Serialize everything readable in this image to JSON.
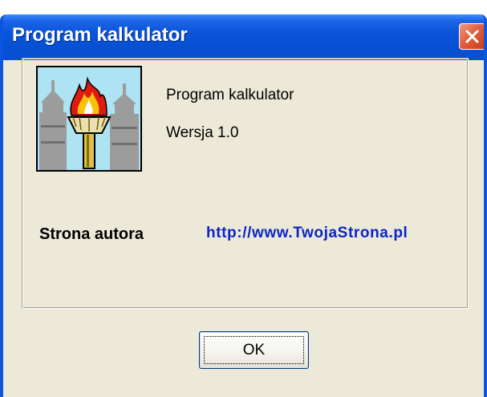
{
  "window": {
    "title": "Program kalkulator"
  },
  "about": {
    "program_name": "Program kalkulator",
    "version": "Wersja 1.0",
    "author_label": "Strona autora",
    "author_url": "http://www.TwojaStrona.pl"
  },
  "buttons": {
    "ok_label": "OK"
  },
  "icons": {
    "close": "close-icon",
    "app": "torch-icon"
  },
  "colors": {
    "titlebar": "#0a55da",
    "window_bg": "#ece9d8",
    "link": "#0a24c8",
    "close_button": "#e3603f"
  }
}
